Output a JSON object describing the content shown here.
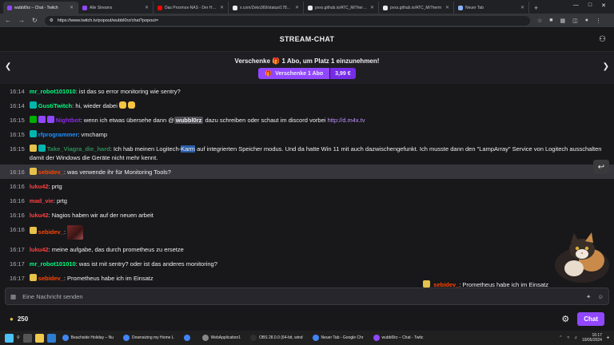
{
  "browser": {
    "tabs": [
      {
        "title": "wubbl0rz – Chat - Twitch",
        "color": "#9147ff",
        "active": true
      },
      {
        "title": "Alle Streams",
        "color": "#9147ff",
        "active": false
      },
      {
        "title": "Das Proxmox-NAS - Der Home",
        "color": "#ff0000",
        "active": false
      },
      {
        "title": "x.com/Zeko369/status/178114",
        "color": "#e8eaed",
        "active": false
      },
      {
        "title": "pvxs.github.io/ATC_MiThermo",
        "color": "#e8eaed",
        "active": false
      },
      {
        "title": "pvxs.github.io/ATC_MiTherm",
        "color": "#e8eaed",
        "active": false
      },
      {
        "title": "Neuer Tab",
        "color": "#8ab4f8",
        "active": false
      }
    ],
    "url": "https://www.twitch.tv/popout/wubbl0rz/chat?popout="
  },
  "header": {
    "title": "STREAM-CHAT"
  },
  "banner": {
    "prefix": "Verschenke",
    "count": "1",
    "suffix": "Abo, um Platz 1 einzunehmen!",
    "gift_label": "Verschenke 1 Abo",
    "price": "3,99 €"
  },
  "messages": [
    {
      "time": "16:14",
      "user": "mr_robot101010",
      "color": "#00ff7f",
      "text": ": ist das so error monitoring wie sentry?",
      "badges": []
    },
    {
      "time": "16:14",
      "user": "GustiTwitch",
      "color": "#00ff7f",
      "text": ": hi, wieder dabei",
      "badges": [
        "#00b5ad"
      ]
    },
    {
      "time": "16:15",
      "user": "Nightbot",
      "color": "#8a2be2",
      "text_a": ": wenn ich etwas übersehe dann @",
      "mention": "wubbl0rz",
      "text_b": " dazu schreiben oder schaut im discord vorbei ",
      "link": "http://d.m4x.tv",
      "badges": [
        "#00ad03",
        "#9147ff",
        "#9147ff"
      ]
    },
    {
      "time": "16:15",
      "user": "rfprogrammer",
      "color": "#1e90ff",
      "text": ": vmchamp",
      "badges": [
        "#00b5ad"
      ]
    },
    {
      "time": "16:15",
      "user": "Take_Viagra_die_hard",
      "color": "#2e8b57",
      "text_a": ": Ich hab meinen Logitech-",
      "sel": "Karm",
      "text_b": " auf integrierten Speicher modus. Und da hatte Win 11 mit auch dazwischengefunkt. Ich musste dann den \"LampArray\" Service von Logitech ausschalten damit der Windows die Geräte nicht mehr kennt.",
      "badges": [
        "#e6c24a",
        "#00b5ad"
      ]
    },
    {
      "time": "16:16",
      "user": "sebidev_",
      "color": "#ff4500",
      "text": ": was verwende ihr für Monitoring Tools?",
      "badges": [
        "#e6c24a"
      ]
    },
    {
      "time": "16:16",
      "user": "luku42",
      "color": "#ff4040",
      "text": ": prtg",
      "badges": []
    },
    {
      "time": "16:16",
      "user": "mad_vie",
      "color": "#ff4040",
      "text": ": prtg",
      "badges": []
    },
    {
      "time": "16:16",
      "user": "luku42",
      "color": "#ff4040",
      "text": ": Nagios haben wir auf der neuen arbeit",
      "badges": []
    },
    {
      "time": "16:16",
      "user": "sebidev_",
      "color": "#ff4500",
      "text": ":",
      "badges": [
        "#e6c24a"
      ]
    },
    {
      "time": "16:17",
      "user": "luku42",
      "color": "#ff4040",
      "text": ": meine aufgabe, das durch prometheus zu ersetze",
      "badges": []
    },
    {
      "time": "16:17",
      "user": "mr_robot101010",
      "color": "#00ff7f",
      "text": ": was ist mit sentry? oder ist das anderes monitoring?",
      "badges": []
    },
    {
      "time": "16:17",
      "user": "sebidev_",
      "color": "#ff4500",
      "text": ": Prometheus habe ich im Einsatz",
      "badges": [
        "#e6c24a"
      ]
    }
  ],
  "overlay": {
    "user": "sebidev_",
    "text": ": Prometheus habe ich im Einsatz"
  },
  "input": {
    "placeholder": "Eine Nachricht senden"
  },
  "footer": {
    "points": "250",
    "chat_label": "Chat"
  },
  "taskbar": {
    "apps": [
      {
        "label": "Beachside Holiday – Nu",
        "color": "#4285f4"
      },
      {
        "label": "Downsizing my Home L",
        "color": "#4285f4"
      },
      {
        "label": "",
        "color": "#4285f4"
      },
      {
        "label": "WebApplication1",
        "color": "#888888"
      },
      {
        "label": "OBS 28.0.0 (64-bit, wind",
        "color": "#302e31"
      },
      {
        "label": "Neuer Tab - Google Chr",
        "color": "#4285f4"
      },
      {
        "label": "wubbl0rz – Chat - Twitc",
        "color": "#9147ff"
      }
    ],
    "time": "16:17",
    "date": "19/05/2024"
  }
}
